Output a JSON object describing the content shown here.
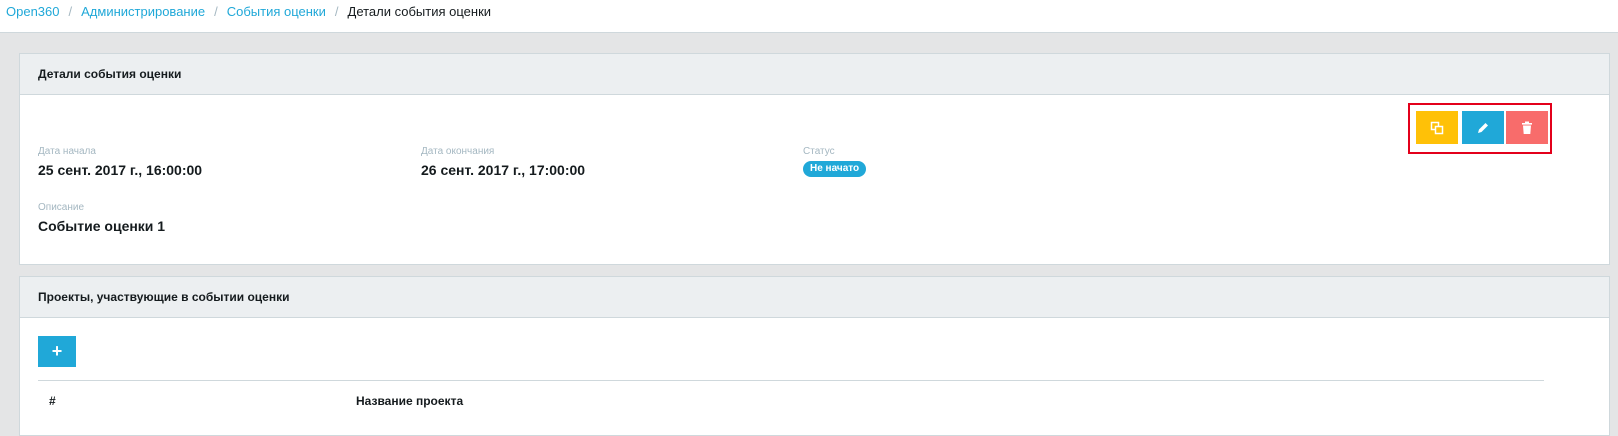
{
  "breadcrumb": {
    "items": [
      "Open360",
      "Администрирование",
      "События оценки"
    ],
    "separator": "/",
    "current": "Детали события оценки"
  },
  "details_card": {
    "title": "Детали события оценки",
    "start": {
      "label": "Дата начала",
      "value": "25 сент. 2017 г., 16:00:00"
    },
    "end": {
      "label": "Дата окончания",
      "value": "26 сент. 2017 г., 17:00:00"
    },
    "status": {
      "label": "Статус",
      "value": "Не начато"
    },
    "description": {
      "label": "Описание",
      "value": "Событие оценки 1"
    },
    "actions": [
      {
        "name": "copy",
        "icon": "copy-icon",
        "color": "#ffc107"
      },
      {
        "name": "edit",
        "icon": "pencil-icon",
        "color": "#20a8d8"
      },
      {
        "name": "delete",
        "icon": "trash-icon",
        "color": "#f86c6b"
      }
    ]
  },
  "projects_card": {
    "title": "Проекты, участвующие в событии оценки",
    "add_label": "+",
    "columns": [
      "#",
      "Название проекта"
    ]
  },
  "colors": {
    "accent": "#20a8d8",
    "highlight": "#e3001b"
  }
}
